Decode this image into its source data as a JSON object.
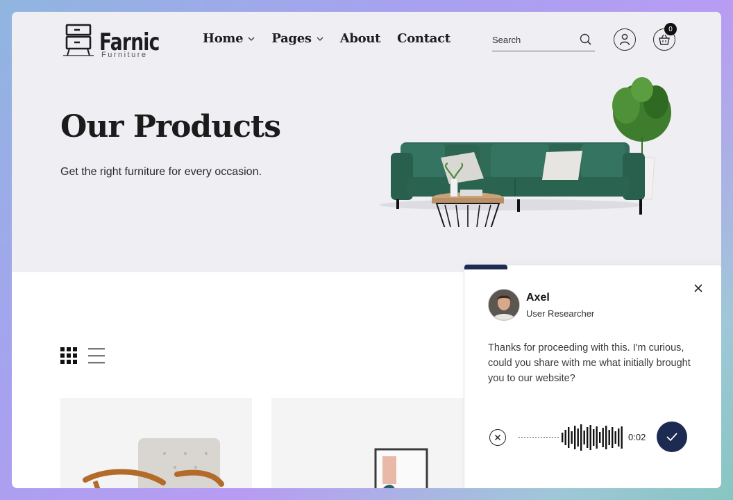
{
  "brand": {
    "name": "Farnic",
    "tagline": "Furniture"
  },
  "nav": {
    "items": [
      "Home",
      "Pages",
      "About",
      "Contact"
    ]
  },
  "search": {
    "placeholder": "Search"
  },
  "cart": {
    "count": "0"
  },
  "hero": {
    "title": "Our Products",
    "subtitle": "Get the right furniture for every occasion."
  },
  "icons": {
    "grid_view": "grid-icon",
    "list_view": "list-icon",
    "search": "search-icon",
    "user": "user-icon",
    "cart": "basket-icon",
    "close": "close-icon",
    "cancel_recording": "x-circle-icon",
    "confirm": "check-icon"
  },
  "chat": {
    "agent_name": "Axel",
    "agent_role": "User Researcher",
    "message": "Thanks for proceeding with this. I'm curious, could you share with me what initially brought you to our website?",
    "recording_time": "0:02"
  },
  "colors": {
    "accent": "#1d2a52",
    "hero_bg": "#efeff3",
    "sofa": "#2f6b57"
  }
}
